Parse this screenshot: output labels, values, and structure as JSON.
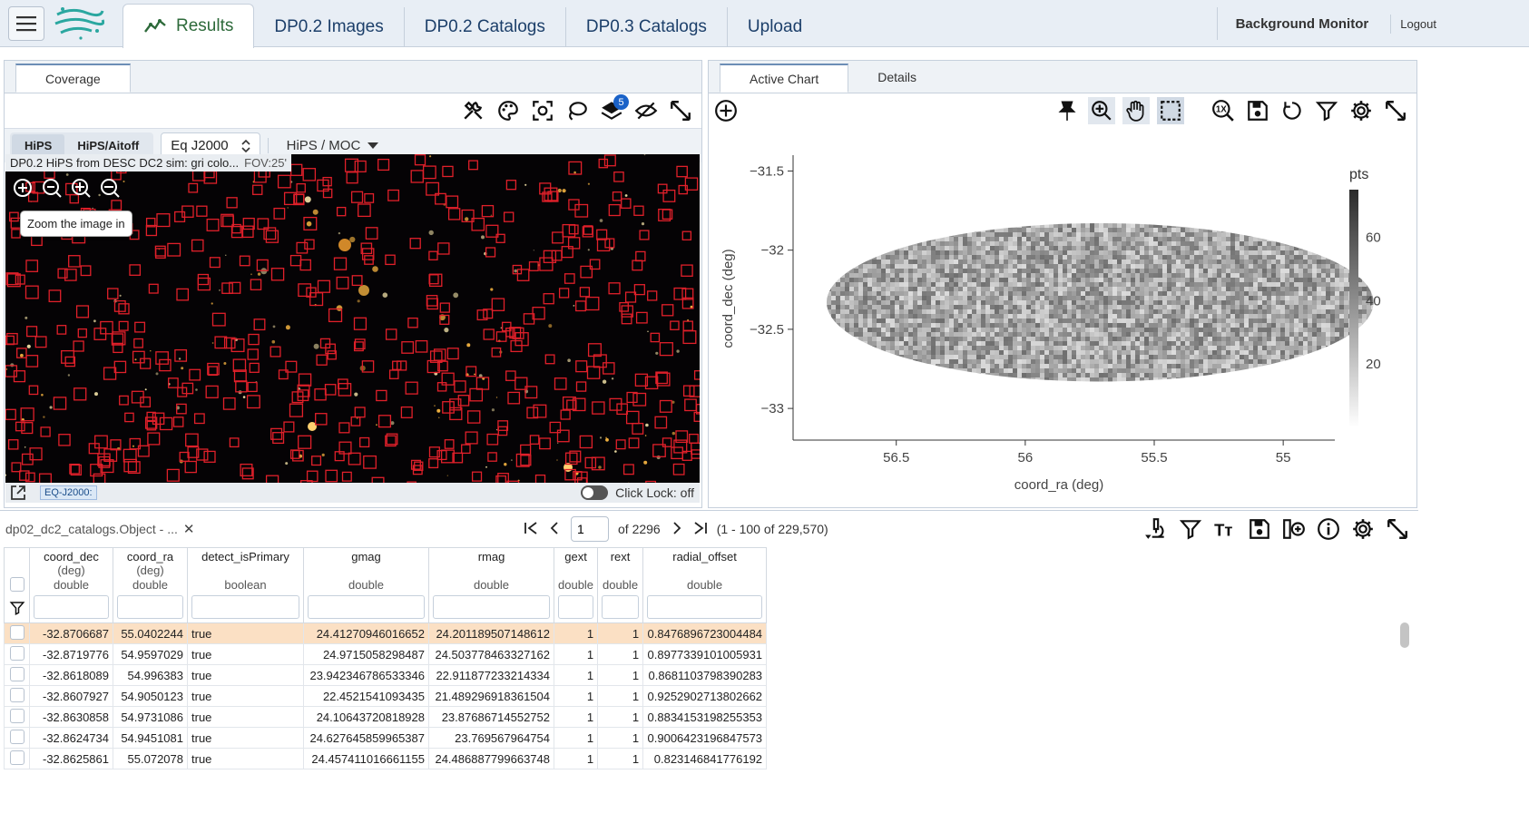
{
  "topbar": {
    "tabs": [
      {
        "label": "Results",
        "active": true,
        "icon": "chart-line-icon"
      },
      {
        "label": "DP0.2 Images"
      },
      {
        "label": "DP0.2 Catalogs"
      },
      {
        "label": "DP0.3 Catalogs"
      },
      {
        "label": "Upload"
      }
    ],
    "background_monitor": "Background Monitor",
    "logout": "Logout"
  },
  "image_panel": {
    "tab": "Coverage",
    "hips_buttons": [
      "HiPS",
      "HiPS/Aitoff"
    ],
    "coord_system": "Eq J2000",
    "layer_menu": "HiPS / MOC",
    "image_title": "DP0.2 HiPS from DESC DC2 sim: gri colo...",
    "fov": "FOV:25'",
    "tooltip": "Zoom the image in",
    "coord_tag": "EQ-J2000:",
    "click_lock": "Click Lock: off",
    "layers_count": "5"
  },
  "chart_panel": {
    "tabs": [
      "Active Chart",
      "Details"
    ],
    "active_tab": "Active Chart"
  },
  "chart_data": {
    "type": "heatmap",
    "xlabel": "coord_ra (deg)",
    "ylabel": "coord_dec (deg)",
    "colorbar_label": "pts",
    "x_ticks": [
      "56.5",
      "56",
      "55.5",
      "55"
    ],
    "y_ticks": [
      "−31.5",
      "−32",
      "−32.5",
      "−33"
    ],
    "colorbar_ticks": [
      "60",
      "40",
      "20"
    ],
    "xlim": [
      56.9,
      54.8
    ],
    "ylim": [
      -33.2,
      -31.4
    ],
    "colorscale": "Greys",
    "region": {
      "shape": "ellipse",
      "center": [
        55.71,
        -32.33
      ],
      "ra_half_width": 1.06,
      "dec_half_width": 0.5
    }
  },
  "table": {
    "title": "dp02_dc2_catalogs.Object - ...",
    "page": "1",
    "of_pages": "of 2296",
    "range": "(1 - 100 of 229,570)",
    "columns": [
      {
        "name": "coord_dec",
        "unit": "(deg)",
        "type": "double"
      },
      {
        "name": "coord_ra",
        "unit": "(deg)",
        "type": "double"
      },
      {
        "name": "detect_isPrimary",
        "unit": "",
        "type": "boolean"
      },
      {
        "name": "gmag",
        "unit": "",
        "type": "double"
      },
      {
        "name": "rmag",
        "unit": "",
        "type": "double"
      },
      {
        "name": "gext",
        "unit": "",
        "type": "double"
      },
      {
        "name": "rext",
        "unit": "",
        "type": "double"
      },
      {
        "name": "radial_offset",
        "unit": "",
        "type": "double"
      }
    ],
    "rows": [
      [
        "-32.8706687",
        "55.0402244",
        "true",
        "24.41270946016652",
        "24.201189507148612",
        "1",
        "1",
        "0.8476896723004484"
      ],
      [
        "-32.8719776",
        "54.9597029",
        "true",
        "24.9715058298487",
        "24.503778463327162",
        "1",
        "1",
        "0.8977339101005931"
      ],
      [
        "-32.8618089",
        "54.996383",
        "true",
        "23.942346786533346",
        "22.911877233214334",
        "1",
        "1",
        "0.8681103798390283"
      ],
      [
        "-32.8607927",
        "54.9050123",
        "true",
        "22.4521541093435",
        "21.489296918361504",
        "1",
        "1",
        "0.9252902713802662"
      ],
      [
        "-32.8630858",
        "54.9731086",
        "true",
        "24.10643720818928",
        "23.87686714552752",
        "1",
        "1",
        "0.8834153198255353"
      ],
      [
        "-32.8624734",
        "54.9451081",
        "true",
        "24.627645859965387",
        "23.769567964754",
        "1",
        "1",
        "0.9006423196847573"
      ],
      [
        "-32.8625861",
        "55.072078",
        "true",
        "24.457411016661155",
        "24.486887799663748",
        "1",
        "1",
        "0.823146841776192"
      ]
    ]
  }
}
